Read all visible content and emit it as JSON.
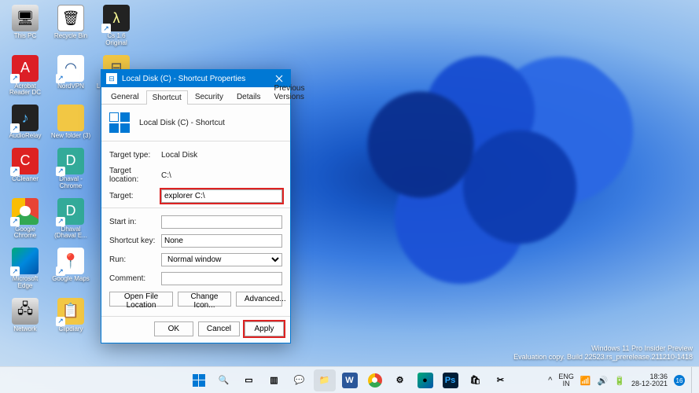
{
  "desktop_icons": [
    {
      "name": "this-pc",
      "label": "This PC",
      "cls": "ic-pc",
      "glyph": "🖥"
    },
    {
      "name": "recycle-bin",
      "label": "Recycle Bin",
      "cls": "ic-bin",
      "glyph": "🗑"
    },
    {
      "name": "cs-original",
      "label": "Cs 1.6 Original",
      "cls": "ic-cs",
      "glyph": "λ",
      "shortcut": true
    },
    {
      "name": "acrobat",
      "label": "Acrobat Reader DC",
      "cls": "ic-pdf",
      "glyph": "A",
      "shortcut": true
    },
    {
      "name": "nordvpn",
      "label": "NordVPN",
      "cls": "ic-vpn",
      "glyph": "◠",
      "shortcut": true
    },
    {
      "name": "local-disk-c",
      "label": "Local Disk (C) - Sh...",
      "cls": "ic-drive",
      "glyph": "⊟",
      "shortcut": true
    },
    {
      "name": "audiorelay",
      "label": "AudioRelay",
      "cls": "ic-relay",
      "glyph": "♪",
      "shortcut": true
    },
    {
      "name": "new-folder-3",
      "label": "New folder (3)",
      "cls": "ic-folder",
      "glyph": ""
    },
    {
      "name": "blank1",
      "label": "",
      "cls": "",
      "glyph": ""
    },
    {
      "name": "ccleaner",
      "label": "CCleaner",
      "cls": "ic-cclean",
      "glyph": "C",
      "shortcut": true
    },
    {
      "name": "dhaval-chrome",
      "label": "Dhaval - Chrome",
      "cls": "ic-chrome2",
      "glyph": "D",
      "shortcut": true
    },
    {
      "name": "blank2",
      "label": "",
      "cls": "",
      "glyph": ""
    },
    {
      "name": "google-chrome",
      "label": "Google Chrome",
      "cls": "ic-chrome",
      "glyph": "",
      "shortcut": true
    },
    {
      "name": "dhaval-e",
      "label": "Dhaval (Dhaval E...",
      "cls": "ic-chrome2",
      "glyph": "D",
      "shortcut": true
    },
    {
      "name": "blank3",
      "label": "",
      "cls": "",
      "glyph": ""
    },
    {
      "name": "microsoft-edge",
      "label": "Microsoft Edge",
      "cls": "ic-edge",
      "glyph": "",
      "shortcut": true
    },
    {
      "name": "google-maps",
      "label": "Google Maps",
      "cls": "ic-maps",
      "glyph": "📍",
      "shortcut": true
    },
    {
      "name": "blank4",
      "label": "",
      "cls": "",
      "glyph": ""
    },
    {
      "name": "network",
      "label": "Network",
      "cls": "ic-net",
      "glyph": "🖧"
    },
    {
      "name": "clipdiary",
      "label": "Clipdiary",
      "cls": "ic-clip",
      "glyph": "📋",
      "shortcut": true
    }
  ],
  "dialog": {
    "title": "Local Disk (C) - Shortcut Properties",
    "tabs": [
      "General",
      "Shortcut",
      "Security",
      "Details",
      "Previous Versions"
    ],
    "active_tab": 1,
    "header_text": "Local Disk (C) - Shortcut",
    "fields": {
      "target_type_label": "Target type:",
      "target_type_value": "Local Disk",
      "target_location_label": "Target location:",
      "target_location_value": "C:\\",
      "target_label": "Target:",
      "target_value": "explorer C:\\",
      "start_in_label": "Start in:",
      "start_in_value": "",
      "shortcut_key_label": "Shortcut key:",
      "shortcut_key_value": "None",
      "run_label": "Run:",
      "run_value": "Normal window",
      "comment_label": "Comment:",
      "comment_value": ""
    },
    "buttons": {
      "open_file_location": "Open File Location",
      "change_icon": "Change Icon...",
      "advanced": "Advanced...",
      "ok": "OK",
      "cancel": "Cancel",
      "apply": "Apply"
    }
  },
  "watermark": {
    "line1": "Windows 11 Pro Insider Preview",
    "line2": "Evaluation copy. Build 22523.rs_prerelease.211210-1418"
  },
  "taskbar": {
    "items": [
      {
        "name": "start",
        "glyph": "win"
      },
      {
        "name": "search",
        "glyph": "🔍"
      },
      {
        "name": "task-view",
        "glyph": "▭"
      },
      {
        "name": "widgets",
        "glyph": "▥"
      },
      {
        "name": "chat",
        "glyph": "💬"
      },
      {
        "name": "file-explorer",
        "glyph": "📁",
        "active": true
      },
      {
        "name": "word",
        "glyph": "W",
        "bg": "#2b579a",
        "fg": "#fff"
      },
      {
        "name": "chrome",
        "glyph": "●",
        "cls": "ic-chrome"
      },
      {
        "name": "settings",
        "glyph": "⚙"
      },
      {
        "name": "edge",
        "glyph": "●",
        "bg": "linear-gradient(135deg,#0a7,#05a)"
      },
      {
        "name": "photoshop",
        "glyph": "Ps",
        "bg": "#001e36",
        "fg": "#31a8ff"
      },
      {
        "name": "store",
        "glyph": "🛍"
      },
      {
        "name": "snip",
        "glyph": "✂"
      }
    ]
  },
  "tray": {
    "chevron": "^",
    "lang_top": "ENG",
    "lang_bottom": "IN",
    "wifi": "📶",
    "volume": "🔊",
    "battery": "🔋",
    "time": "18:36",
    "date": "28-12-2021",
    "notifications": "16"
  }
}
